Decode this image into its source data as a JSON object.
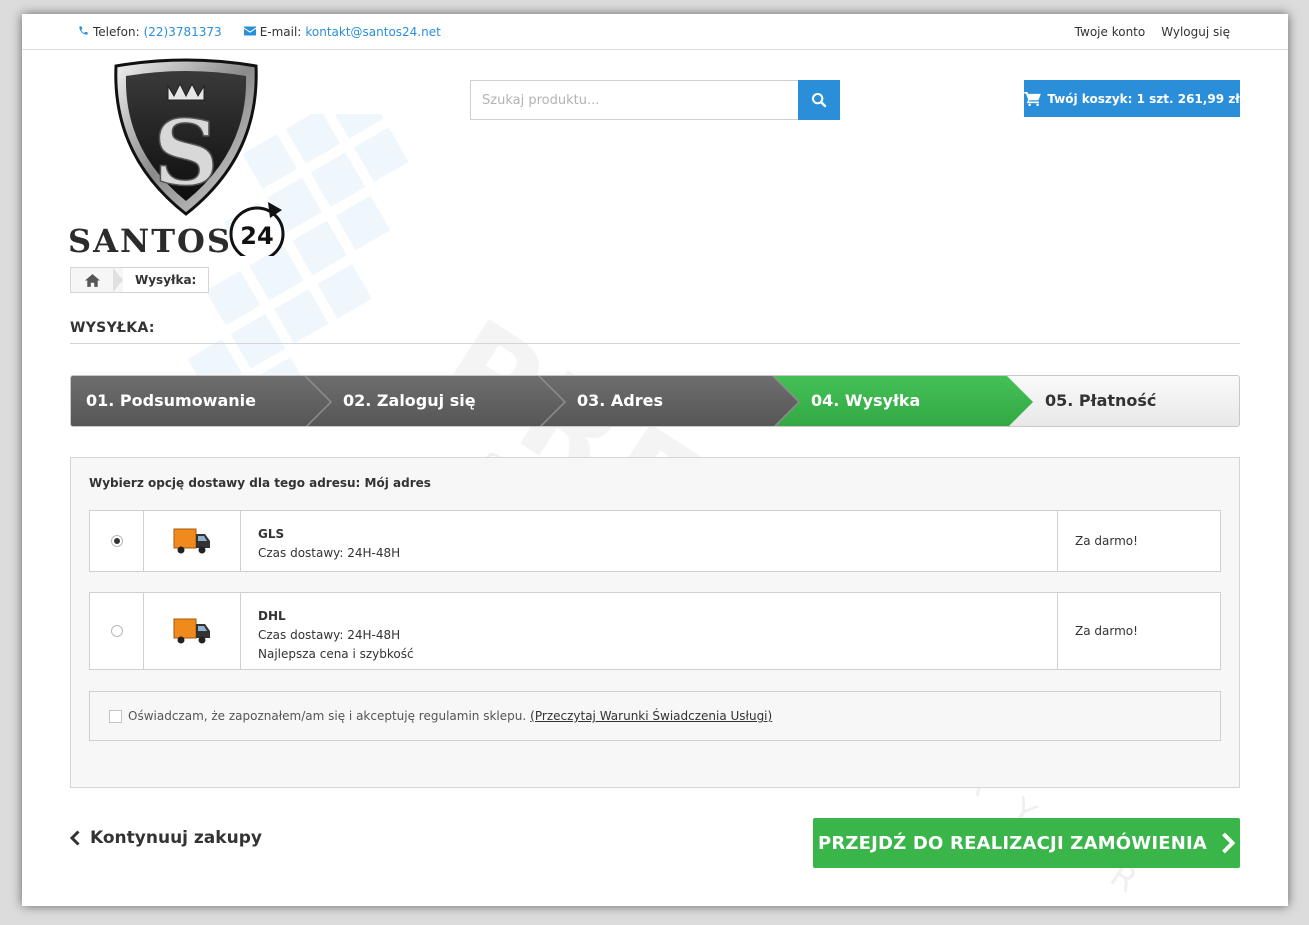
{
  "topbar": {
    "phone_label": "Telefon:",
    "phone_value": "(22)3781373",
    "email_label": "E-mail:",
    "email_value": "kontakt@santos24.net",
    "account_link": "Twoje konto",
    "logout_link": "Wyloguj się"
  },
  "logo": {
    "brand": "SANTOS",
    "badge": "24",
    "letter": "S"
  },
  "search": {
    "placeholder": "Szukaj produktu..."
  },
  "cart": {
    "label": "Twój koszyk: 1 szt. 261,99 zł"
  },
  "breadcrumb": {
    "current": "Wysyłka:"
  },
  "page_title": "WYSYŁKA:",
  "steps": [
    {
      "label": "01. Podsumowanie",
      "state": "done"
    },
    {
      "label": "02. Zaloguj się",
      "state": "done"
    },
    {
      "label": "03. Adres",
      "state": "done"
    },
    {
      "label": "04. Wysyłka",
      "state": "current"
    },
    {
      "label": "05. Płatność",
      "state": "todo"
    }
  ],
  "shipping": {
    "prompt": "Wybierz opcję dostawy dla tego adresu: Mój adres",
    "carriers": [
      {
        "name": "GLS",
        "delay": "Czas dostawy: 24H-48H",
        "extra": "",
        "price": "Za darmo!",
        "selected": true
      },
      {
        "name": "DHL",
        "delay": "Czas dostawy: 24H-48H",
        "extra": "Najlepsza cena i szybkość",
        "price": "Za darmo!",
        "selected": false
      }
    ],
    "terms_text": "Oświadczam, że zapoznałem/am się i akceptuję regulamin sklepu.",
    "terms_link": "(Przeczytaj Warunki Świadczenia Usługi)"
  },
  "actions": {
    "continue": "Kontynuuj zakupy",
    "proceed": "PRZEJDŹ DO REALIZACJI ZAMÓWIENIA"
  },
  "watermark": {
    "main": "PREBYTES",
    "sub": "SECURITY LAYER"
  },
  "colors": {
    "accent_blue": "#2a8fd8",
    "step_done": "#5f5f5f",
    "step_current": "#39b54a",
    "proceed_green": "#39b54a"
  }
}
